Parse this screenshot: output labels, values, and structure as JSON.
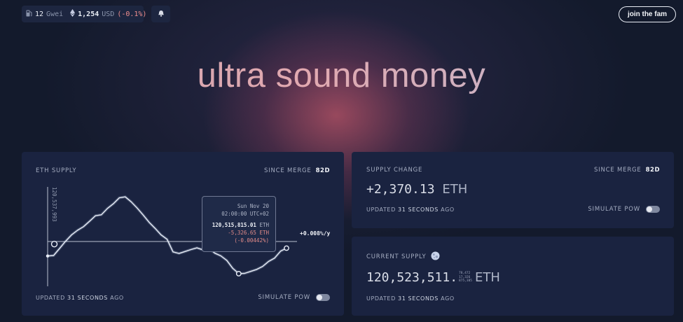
{
  "topbar": {
    "gas_value": "12",
    "gas_unit": "Gwei",
    "eth_price": "1,254",
    "price_unit": "USD",
    "price_change": "(-0.1%)",
    "join_label": "join the fam"
  },
  "icons": {
    "gas": "fuel-pump-icon",
    "eth": "ethereum-icon",
    "bell": "bell-icon",
    "moon": "moon-icon"
  },
  "headline": "ultra sound money",
  "supply_card": {
    "label": "ETH SUPPLY",
    "since_label": "SINCE MERGE",
    "since_days": "82d",
    "y_tick": "120,537,993",
    "end_label": "+0.008%/y",
    "updated_prefix": "UPDATED",
    "updated_value": "31 SECONDS",
    "updated_suffix": "AGO",
    "simulate_label": "SIMULATE PoW",
    "simulate_on": false,
    "tooltip": {
      "date": "Sun Nov 20",
      "time": "02:00:00 UTC+02",
      "supply": "120,515,815.01",
      "supply_unit": "ETH",
      "delta": "-5,326.65 ETH",
      "delta_pct": "(-0.00442%)"
    }
  },
  "chart_data": {
    "type": "line",
    "title": "ETH SUPPLY",
    "xlabel": "",
    "ylabel": "",
    "y_tick_labels": [
      "120,537,993"
    ],
    "series": [
      {
        "values": [
          120521142,
          120521300,
          120523400,
          120525600,
          120527500,
          120528900,
          120530000,
          120531600,
          120533300,
          120533600,
          120535500,
          120536900,
          120538700,
          120539000,
          120537500,
          120535600,
          120533500,
          120531300,
          120529500,
          120527500,
          120526200,
          120522400,
          120521900,
          120522500,
          120523100,
          120523600,
          120523000,
          120523500,
          120522000,
          120521200,
          120519800,
          120517400,
          120515815,
          120515900,
          120516500,
          120517100,
          120518000,
          120519500,
          120520500,
          120522600,
          120523511
        ]
      }
    ],
    "ylim": [
      120512000,
      120542000
    ],
    "grid": false,
    "annotations": [
      "+0.008%/y"
    ]
  },
  "supply_change_card": {
    "label": "SUPPLY CHANGE",
    "since_label": "SINCE MERGE",
    "since_days": "82d",
    "value": "+2,370.13",
    "unit": "ETH",
    "updated_prefix": "UPDATED",
    "updated_value": "31 SECONDS",
    "updated_suffix": "AGO",
    "simulate_label": "SIMULATE PoW",
    "simulate_on": false
  },
  "current_supply_card": {
    "label": "CURRENT SUPPLY",
    "integer": "120,523,511.",
    "decimals_lines": [
      "78,472",
      "17,326",
      "875,385"
    ],
    "unit": "ETH",
    "updated_prefix": "UPDATED",
    "updated_value": "31 SECONDS",
    "updated_suffix": "AGO"
  },
  "colors": {
    "background": "#131a2c",
    "card": "#1a2340",
    "accent_pink": "#d69ca6",
    "negative": "#ef8e8e"
  }
}
